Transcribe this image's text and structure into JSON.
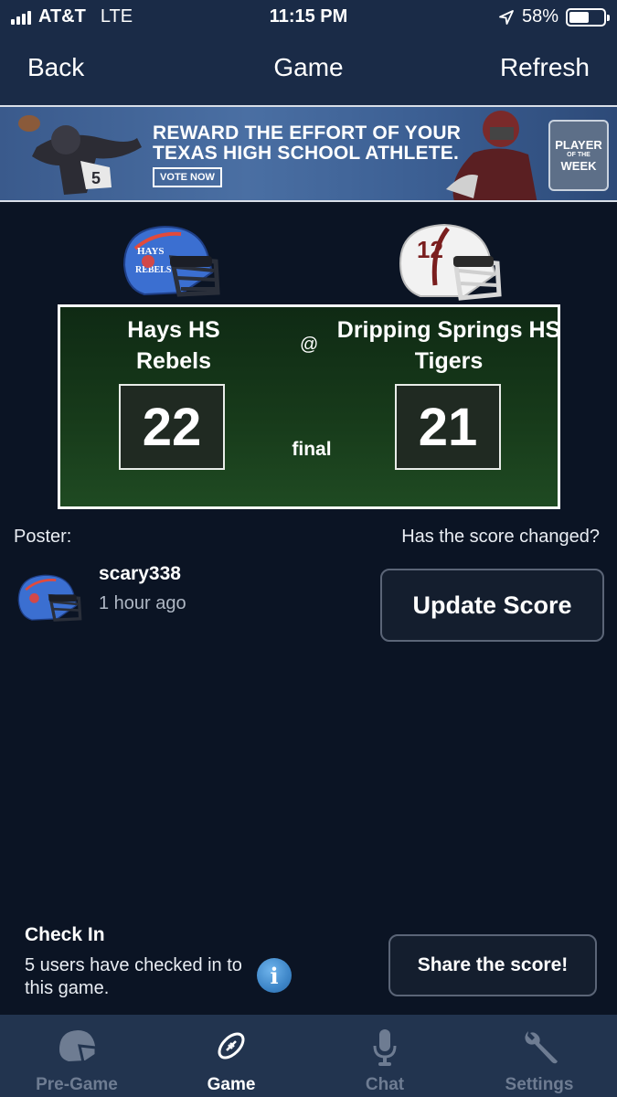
{
  "status_bar": {
    "carrier": "AT&T",
    "network": "LTE",
    "time": "11:15 PM",
    "battery": "58%",
    "battery_level": 0.58
  },
  "nav": {
    "back": "Back",
    "title": "Game",
    "refresh": "Refresh"
  },
  "ad": {
    "line1": "REWARD THE EFFORT OF YOUR",
    "line2": "TEXAS HIGH SCHOOL ATHLETE.",
    "cta": "VOTE NOW",
    "badge_line1": "PLAYER",
    "badge_line2": "WEEK"
  },
  "game": {
    "home": {
      "school": "Hays HS",
      "mascot": "Rebels",
      "score": "22",
      "helmet_color": "#3b6fd1"
    },
    "separator": "@",
    "away": {
      "school": "Dripping Springs HS",
      "mascot": "Tigers",
      "score": "21",
      "helmet_number": "12",
      "helmet_color": "#f2f2f2"
    },
    "status": "final"
  },
  "poster": {
    "label": "Poster:",
    "changed_prompt": "Has the score changed?",
    "username": "scary338",
    "time_ago": "1 hour ago",
    "update_button": "Update Score"
  },
  "checkin": {
    "title": "Check In",
    "text": "5 users have checked in to this game.",
    "share_button": "Share the score!"
  },
  "tabs": [
    {
      "label": "Pre-Game",
      "icon": "helmet-icon",
      "active": false
    },
    {
      "label": "Game",
      "icon": "football-icon",
      "active": true
    },
    {
      "label": "Chat",
      "icon": "microphone-icon",
      "active": false
    },
    {
      "label": "Settings",
      "icon": "wrench-icon",
      "active": false
    }
  ],
  "colors": {
    "background": "#0b1424",
    "bar": "#1a2b47",
    "board": "#173a1a",
    "tab_inactive": "#6e7c92"
  }
}
